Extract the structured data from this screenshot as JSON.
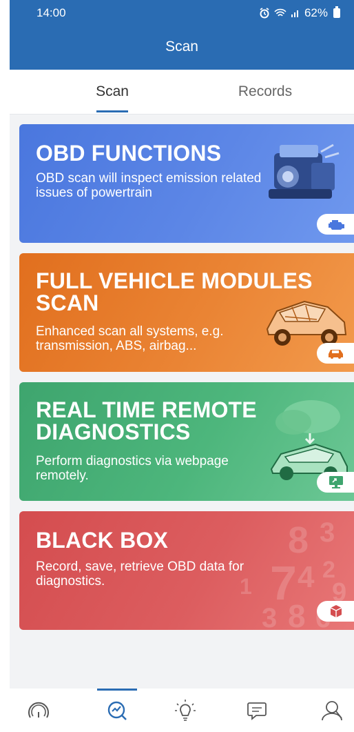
{
  "status": {
    "time": "14:00",
    "battery": "62%"
  },
  "header": {
    "title": "Scan"
  },
  "tabs": [
    {
      "label": "Scan"
    },
    {
      "label": "Records"
    }
  ],
  "cards": [
    {
      "title": "OBD FUNCTIONS",
      "description": "OBD scan will inspect emission related issues of powertrain",
      "icon": "engine-icon"
    },
    {
      "title": "FULL VEHICLE MODULES SCAN",
      "description": "Enhanced scan all systems, e.g. transmission, ABS, airbag...",
      "icon": "car-icon"
    },
    {
      "title": "REAL TIME REMOTE DIAGNOSTICS",
      "description": "Perform diagnostics via webpage remotely.",
      "icon": "monitor-icon"
    },
    {
      "title": "BLACK BOX",
      "description": "Record, save, retrieve OBD data for diagnostics.",
      "icon": "cube-icon"
    }
  ],
  "bottom_nav": [
    "gauge-icon",
    "scan-icon",
    "bulb-icon",
    "chat-icon",
    "user-icon"
  ],
  "colors": {
    "header": "#2a6cb3",
    "obd": "#4a77de",
    "full_vehicle": "#e16f1e",
    "remote": "#3ea56e",
    "black_box": "#d44d4f"
  }
}
